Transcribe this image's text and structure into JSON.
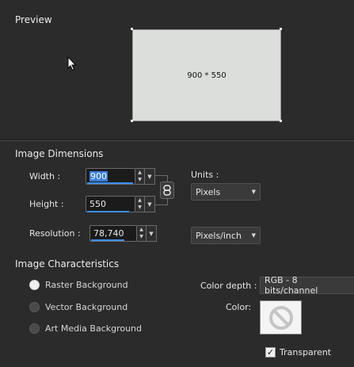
{
  "preview": {
    "title": "Preview",
    "size_text": "900 * 550"
  },
  "dimensions": {
    "title": "Image Dimensions",
    "width_label": "Width :",
    "width_value": "900",
    "height_label": "Height :",
    "height_value": "550",
    "resolution_label": "Resolution :",
    "resolution_value": "78,740",
    "units_label": "Units :",
    "units_value": "Pixels",
    "resolution_units_value": "Pixels/inch"
  },
  "characteristics": {
    "title": "Image Characteristics",
    "background_options": [
      {
        "label": "Raster Background",
        "selected": true
      },
      {
        "label": "Vector Background",
        "selected": false
      },
      {
        "label": "Art Media Background",
        "selected": false
      }
    ],
    "color_depth_label": "Color depth :",
    "color_depth_value": "RGB - 8 bits/channel",
    "color_label": "Color:",
    "transparent_label": "Transparent",
    "transparent_checked": true
  },
  "colors": {
    "accent": "#3a8ef0",
    "background": "#2b2b2b",
    "preview_fill": "#dcdedb"
  }
}
